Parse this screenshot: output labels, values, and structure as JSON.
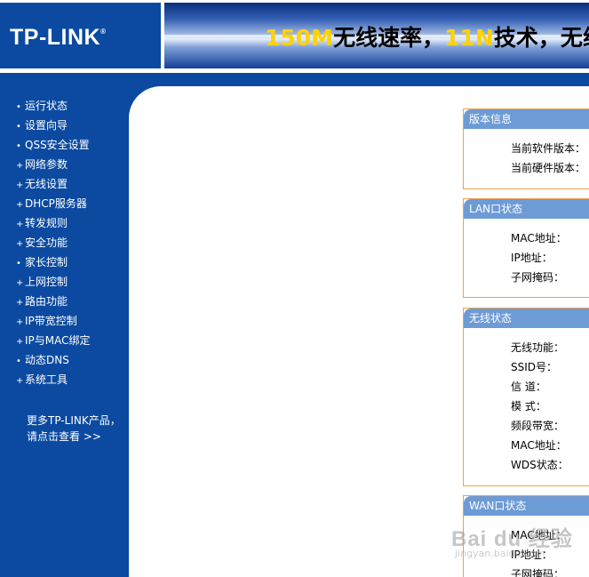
{
  "header": {
    "logo": "TP-LINK",
    "banner_highlight_1": "150M",
    "banner_mid": "无线速率，",
    "banner_highlight_2": "11N",
    "banner_tail": "技术，无线"
  },
  "sidebar": {
    "items": [
      {
        "label": "运行状态",
        "mark": "•"
      },
      {
        "label": "设置向导",
        "mark": "•"
      },
      {
        "label": "QSS安全设置",
        "mark": "•"
      },
      {
        "label": "网络参数",
        "mark": "+"
      },
      {
        "label": "无线设置",
        "mark": "+"
      },
      {
        "label": "DHCP服务器",
        "mark": "+"
      },
      {
        "label": "转发规则",
        "mark": "+"
      },
      {
        "label": "安全功能",
        "mark": "+"
      },
      {
        "label": "家长控制",
        "mark": "•"
      },
      {
        "label": "上网控制",
        "mark": "+"
      },
      {
        "label": "路由功能",
        "mark": "+"
      },
      {
        "label": "IP带宽控制",
        "mark": "+"
      },
      {
        "label": "IP与MAC绑定",
        "mark": "+"
      },
      {
        "label": "动态DNS",
        "mark": "•"
      },
      {
        "label": "系统工具",
        "mark": "+"
      }
    ],
    "more_line1": "更多TP-LINK产品，",
    "more_line2": "请点击查看 >>"
  },
  "panels": {
    "version": {
      "title": "版本信息",
      "rows": [
        "当前软件版本：",
        "当前硬件版本："
      ]
    },
    "lan": {
      "title": "LAN口状态",
      "rows": [
        "MAC地址：",
        "IP地址：",
        "子网掩码："
      ]
    },
    "wireless": {
      "title": "无线状态",
      "rows": [
        "无线功能：",
        "SSID号：",
        "信 道：",
        "模 式：",
        "频段带宽：",
        "MAC地址：",
        "WDS状态："
      ]
    },
    "wan": {
      "title": "WAN口状态",
      "rows": [
        "MAC地址：",
        "IP地址：",
        "子网掩码："
      ]
    }
  },
  "watermark": {
    "main": "Bai du 经验",
    "sub": "jingyan.baidu.com"
  },
  "colors": {
    "brand_blue": "#0b4aa0",
    "panel_title": "#6c9bd6",
    "panel_border": "#f0a04a",
    "banner_highlight": "#ffd200"
  }
}
